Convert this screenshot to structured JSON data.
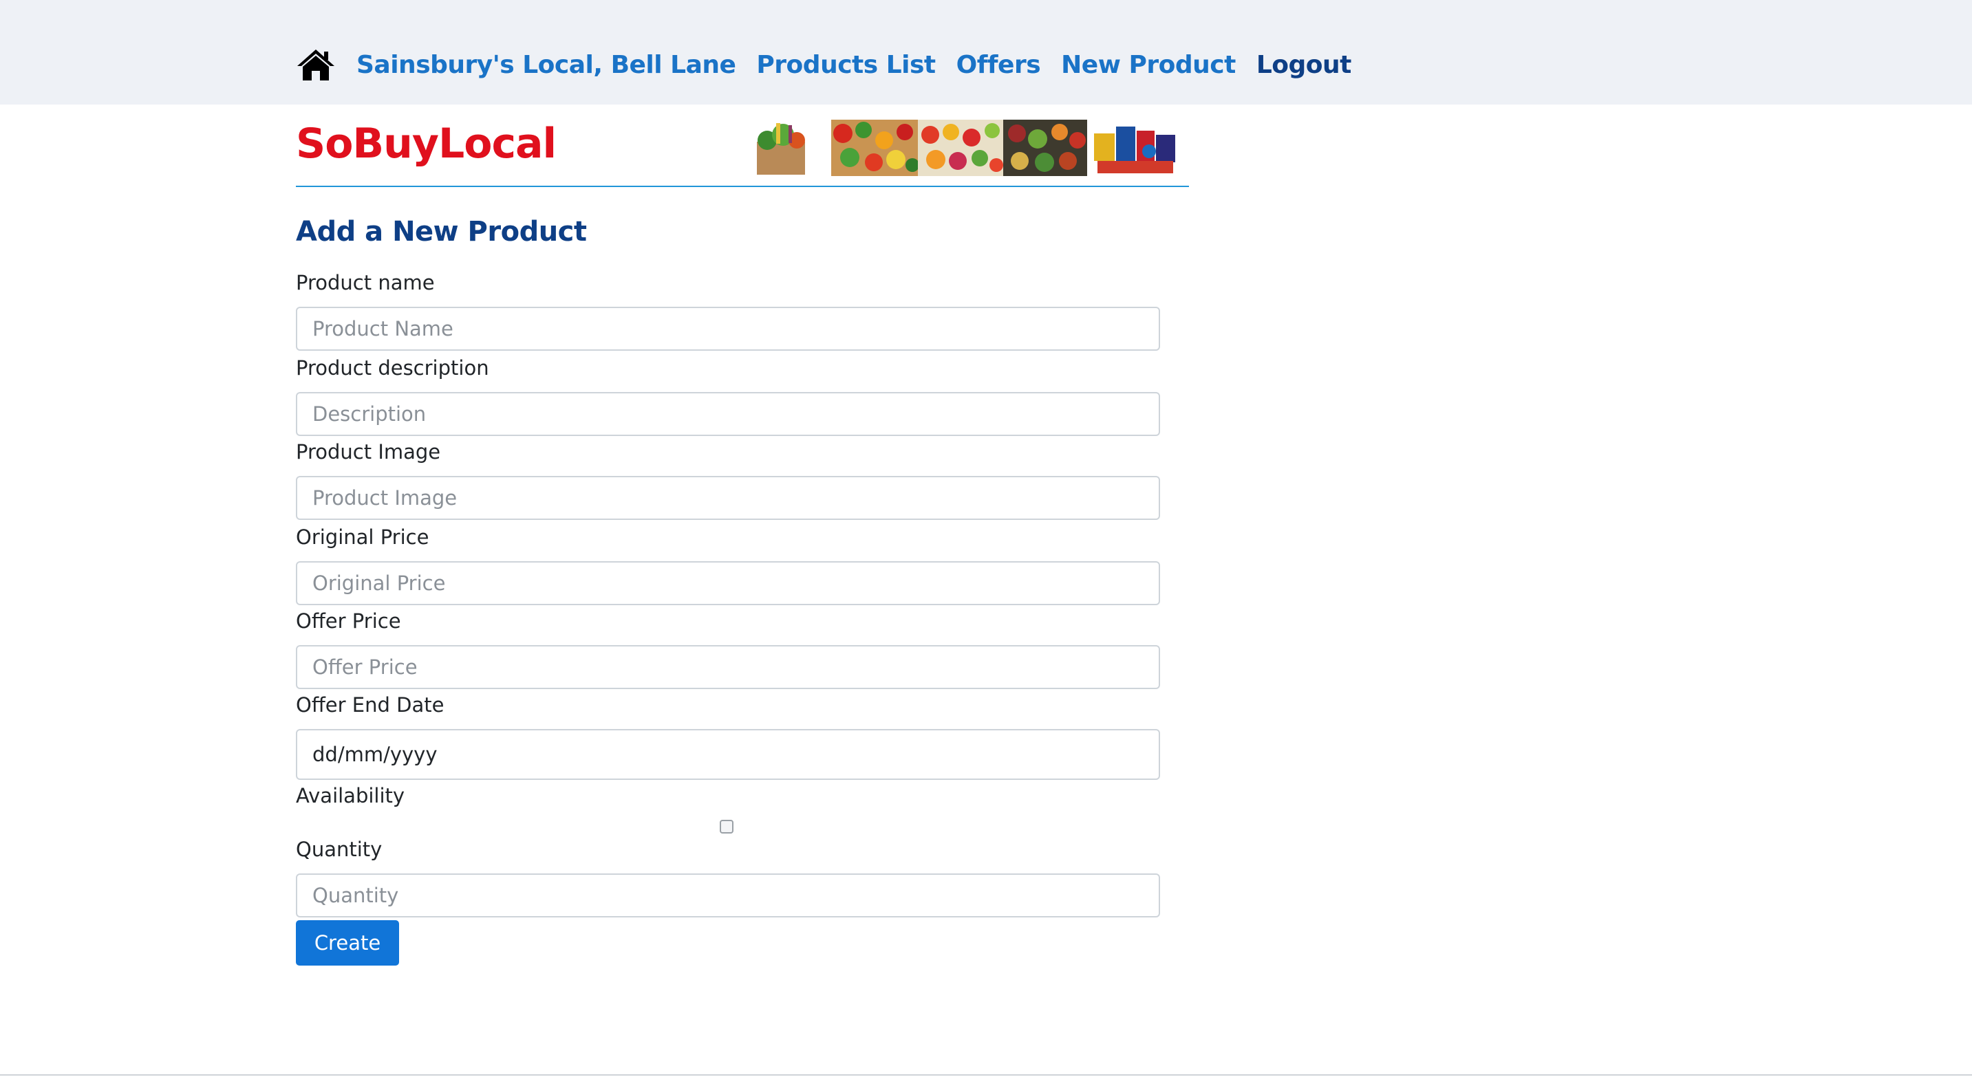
{
  "nav": {
    "home_icon": "home-icon",
    "store_label": "Sainsbury's Local, Bell Lane",
    "products_list_label": "Products List",
    "offers_label": "Offers",
    "new_product_label": "New Product",
    "logout_label": "Logout"
  },
  "brand": {
    "name": "SoBuyLocal",
    "color": "#e0101d"
  },
  "form": {
    "title": "Add a New Product",
    "fields": {
      "product_name": {
        "label": "Product name",
        "placeholder": "Product Name"
      },
      "description": {
        "label": "Product description",
        "placeholder": "Description"
      },
      "image": {
        "label": "Product Image",
        "placeholder": "Product Image"
      },
      "original_price": {
        "label": "Original Price",
        "placeholder": "Original Price"
      },
      "offer_price": {
        "label": "Offer Price",
        "placeholder": "Offer Price"
      },
      "offer_end_date": {
        "label": "Offer End Date",
        "value": "dd/mm/yyyy"
      },
      "availability": {
        "label": "Availability",
        "checked": false
      },
      "quantity": {
        "label": "Quantity",
        "placeholder": "Quantity"
      }
    },
    "submit_label": "Create"
  },
  "colors": {
    "accent_blue": "#1a73c7",
    "dark_blue": "#0e3f86",
    "button_blue": "#1175d8",
    "topbar_bg": "#eef1f6"
  }
}
